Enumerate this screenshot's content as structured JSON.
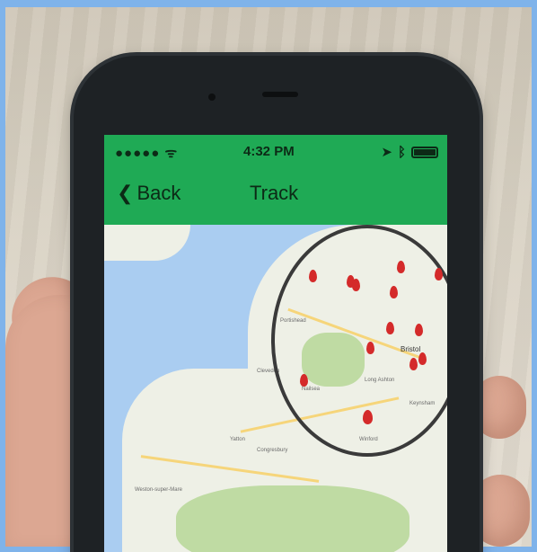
{
  "status_bar": {
    "signal": "●●●●● ᯤ",
    "time": "4:32 PM"
  },
  "navigation": {
    "back_label": "Back",
    "title": "Track"
  },
  "map": {
    "labels": [
      "Bristol",
      "Weston-super-Mare",
      "Clevedon",
      "Portishead",
      "Nailsea",
      "Long Ashton",
      "Winford",
      "Keynsham",
      "Congresbury",
      "Yatton"
    ]
  },
  "colors": {
    "header": "#1faa55",
    "marker": "#d42a2a",
    "water": "#aacdf1"
  }
}
